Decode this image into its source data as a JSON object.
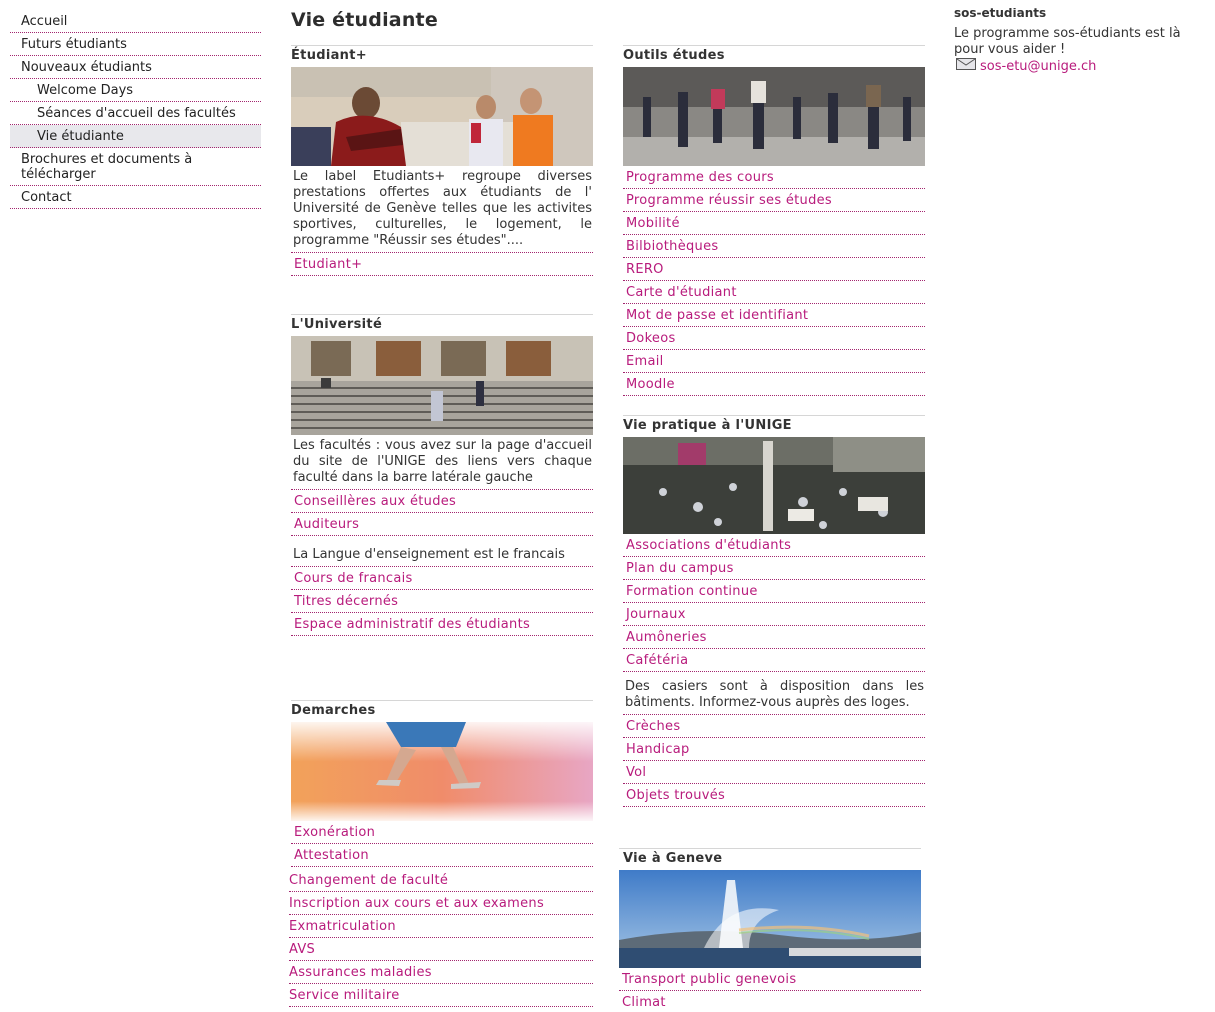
{
  "sidebar": {
    "items": [
      {
        "label": "Accueil"
      },
      {
        "label": "Futurs étudiants"
      },
      {
        "label": "Nouveaux étudiants"
      },
      {
        "label": "Welcome Days"
      },
      {
        "label": "Séances d'accueil des facultés"
      },
      {
        "label": "Vie étudiante"
      },
      {
        "label": "Brochures et documents à télécharger"
      },
      {
        "label": "Contact"
      }
    ]
  },
  "page": {
    "title": "Vie étudiante"
  },
  "sections": {
    "etudiant_plus": {
      "title": "Étudiant+",
      "description": "Le label Etudiants+ regroupe diverses prestations offertes aux étudiants de l' Université de Genève telles que les activites sportives, culturelles, le logement, le programme \"Réussir ses études\"....",
      "links": [
        "Etudiant+"
      ]
    },
    "universite": {
      "title": "L'Université",
      "description": "Les facultés : vous avez sur la page d'accueil du site de l'UNIGE des liens vers chaque faculté dans la barre latérale gauche",
      "links_a": [
        "Conseillères aux études",
        "Auditeurs"
      ],
      "description2": "La Langue d'enseignement est le francais",
      "links_b": [
        "Cours de francais",
        "Titres décernés",
        "Espace administratif des étudiants"
      ]
    },
    "demarches": {
      "title": "Demarches",
      "links_a": [
        "Exonération",
        "Attestation"
      ],
      "links_b": [
        "Changement de faculté",
        "Inscription aux cours et aux examens",
        "Exmatriculation",
        "AVS",
        "Assurances maladies",
        "Service militaire"
      ]
    },
    "outils": {
      "title": "Outils études",
      "links": [
        "Programme des cours",
        "Programme réussir ses études",
        "Mobilité",
        "Bilbiothèques",
        "RERO",
        "Carte d'étudiant",
        "Mot de passe et identifiant",
        "Dokeos",
        "Email",
        "Moodle"
      ]
    },
    "vie_pratique": {
      "title": "Vie pratique à l'UNIGE",
      "links_a": [
        "Associations d'étudiants",
        "Plan du campus",
        "Formation continue",
        "Journaux",
        "Aumôneries",
        "Cafétéria"
      ],
      "description": "Des casiers sont à disposition dans les bâtiments. Informez-vous auprès des loges.",
      "links_b": [
        "Crèches",
        "Handicap",
        "Vol",
        "Objets trouvés"
      ]
    },
    "geneve": {
      "title": "Vie à Geneve",
      "links": [
        "Transport public genevois",
        "Climat"
      ]
    }
  },
  "sos": {
    "title": "sos-etudiants",
    "text": "Le programme sos-étudiants est là pour vous aider !",
    "email": "sos-etu@unige.ch"
  },
  "colors": {
    "link": "#b81b7c",
    "divider": "#a3266f",
    "active_bg": "#e8e8ec"
  },
  "icons": {
    "email": "envelope-icon"
  }
}
